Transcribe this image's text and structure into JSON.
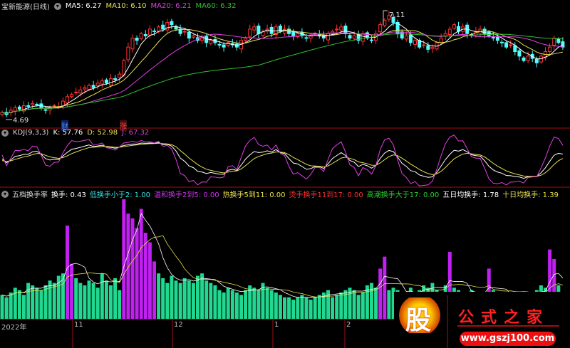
{
  "main_panel": {
    "title": "宝新能源(日线)",
    "ma5": "MA5: 6.27",
    "ma10": "MA10: 6.10",
    "ma20": "MA20: 6.21",
    "ma60": "MA60: 6.32",
    "high_label": "7.11",
    "low_label": "4.69",
    "marker_cai": "财",
    "marker_zhang": "涨"
  },
  "kdj_panel": {
    "title": "KDJ(9,3,3)",
    "k": "K: 57.76",
    "d": "D: 52.98",
    "j": "J: 67.32"
  },
  "turnover_panel": {
    "title": "五档换手率",
    "t0": "换手: 0.43",
    "t1": "低换手小于2: 1.00",
    "t2": "温和换手2到5: 0.00",
    "t3": "热换手5到11: 0.00",
    "t4": "烫手换手11到17: 0.00",
    "t5": "高潮换手大于17: 0.00",
    "t6": "五日均换手: 1.78",
    "t7": "十日均换手: 1.39"
  },
  "x_axis": [
    "2022年",
    "11",
    "12",
    "1",
    "2"
  ],
  "watermark": {
    "glyph": "股",
    "name": "公式之家",
    "url": "www.gszj100.com"
  },
  "colors": {
    "up": "#ff3232",
    "down": "#54fcfc",
    "ma5": "#ffffff",
    "ma10": "#e8e050",
    "ma20": "#e040e0",
    "ma60": "#30c030",
    "low_turnover": "#20d890",
    "mild_turnover": "#c020f0"
  },
  "chart_data": {
    "type": "candlestick+line+bar",
    "closes": [
      4.85,
      4.8,
      4.9,
      4.95,
      4.92,
      5.0,
      4.98,
      5.05,
      5.02,
      4.95,
      4.9,
      4.95,
      5.0,
      4.98,
      5.1,
      5.2,
      5.25,
      5.3,
      5.35,
      5.4,
      5.45,
      5.4,
      5.5,
      5.55,
      5.5,
      5.6,
      5.58,
      5.7,
      6.0,
      6.3,
      6.5,
      6.45,
      6.6,
      6.55,
      6.7,
      6.65,
      6.75,
      6.7,
      6.85,
      6.8,
      6.7,
      6.6,
      6.65,
      6.5,
      6.55,
      6.45,
      6.5,
      6.4,
      6.45,
      6.4,
      6.35,
      6.3,
      6.4,
      6.35,
      6.3,
      6.45,
      6.5,
      6.7,
      6.75,
      6.6,
      6.65,
      6.7,
      6.6,
      6.75,
      6.65,
      6.7,
      6.6,
      6.55,
      6.6,
      6.55,
      6.5,
      6.55,
      6.6,
      6.55,
      6.5,
      6.6,
      6.65,
      6.7,
      6.75,
      6.6,
      6.5,
      6.55,
      6.45,
      6.6,
      6.5,
      6.45,
      6.6,
      6.8,
      6.9,
      7.0,
      6.85,
      6.6,
      6.5,
      6.55,
      6.4,
      6.45,
      6.3,
      6.35,
      6.25,
      6.3,
      6.4,
      6.5,
      6.6,
      6.7,
      6.8,
      6.65,
      6.75,
      6.6,
      6.55,
      6.65,
      6.7,
      6.6,
      6.55,
      6.5,
      6.45,
      6.4,
      6.3,
      6.35,
      6.2,
      6.1,
      6.0,
      6.1,
      6.05,
      5.95,
      6.1,
      6.2,
      6.3,
      6.5,
      6.4,
      6.3
    ],
    "turnover": [
      1.0,
      0.9,
      1.1,
      1.3,
      1.2,
      1.0,
      1.5,
      1.4,
      1.3,
      1.2,
      1.4,
      1.6,
      1.5,
      1.8,
      1.9,
      3.9,
      2.3,
      1.7,
      1.5,
      1.4,
      1.6,
      1.5,
      1.3,
      1.9,
      1.6,
      1.4,
      1.7,
      1.2,
      5.0,
      4.4,
      4.2,
      3.8,
      4.6,
      3.6,
      3.2,
      2.4,
      1.9,
      1.7,
      1.5,
      1.8,
      1.6,
      1.5,
      1.7,
      1.6,
      1.5,
      1.8,
      1.9,
      1.6,
      1.5,
      1.4,
      1.2,
      1.1,
      1.3,
      1.2,
      1.1,
      1.0,
      1.2,
      1.4,
      1.3,
      1.2,
      1.5,
      1.3,
      1.2,
      1.1,
      1.0,
      0.9,
      0.9,
      0.8,
      0.9,
      1.0,
      0.9,
      0.8,
      0.9,
      1.0,
      1.1,
      1.2,
      0.9,
      1.0,
      1.1,
      1.2,
      1.3,
      1.2,
      1.0,
      1.1,
      1.4,
      1.5,
      1.3,
      2.1,
      2.6,
      1.2,
      1.3,
      1.2,
      0.9,
      1.1,
      1.3,
      1.0,
      1.2,
      1.4,
      1.3,
      1.5,
      1.2,
      1.1,
      1.4,
      2.8,
      1.3,
      1.2,
      1.1,
      1.0,
      1.2,
      1.1,
      1.0,
      1.1,
      2.1,
      1.2,
      1.0,
      0.9,
      1.0,
      1.1,
      0.9,
      1.0,
      1.1,
      1.0,
      0.9,
      1.2,
      1.4,
      1.3,
      2.9,
      2.5,
      1.4,
      0.43
    ],
    "price_range": [
      4.69,
      7.11
    ],
    "kdj_range": [
      0,
      100
    ],
    "turnover_range": [
      0,
      5
    ]
  }
}
